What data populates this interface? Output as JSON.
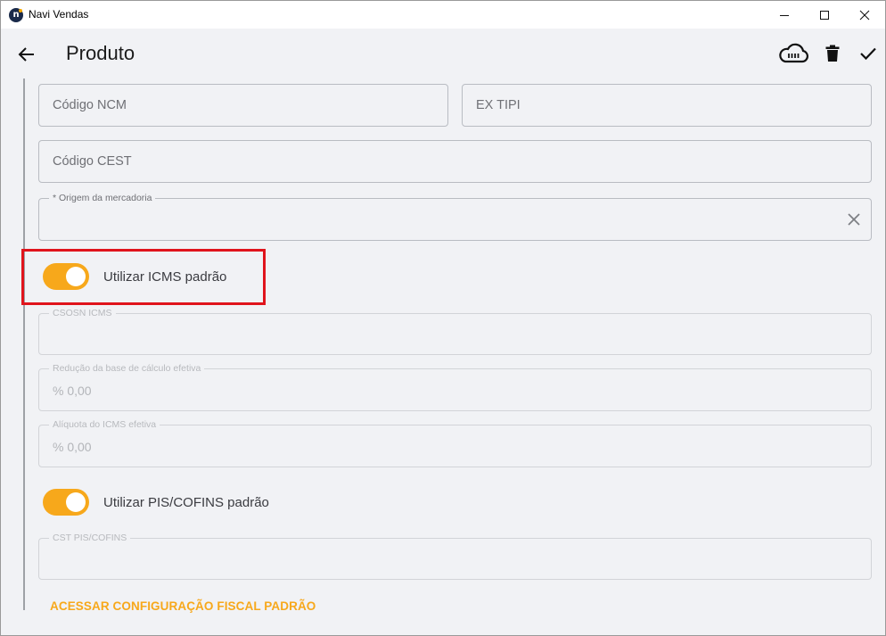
{
  "window": {
    "title": "Navi Vendas",
    "controls": {
      "minimize": "minimize-icon",
      "maximize": "maximize-icon",
      "close": "close-icon"
    }
  },
  "header": {
    "title": "Produto",
    "actions": [
      "cloud-sync-icon",
      "trash-icon",
      "check-icon"
    ]
  },
  "fields": {
    "ncm": {
      "placeholder": "Código NCM"
    },
    "ex_tipi": {
      "placeholder": "EX TIPI"
    },
    "cest": {
      "placeholder": "Código CEST"
    },
    "origem": {
      "label": "* Origem da mercadoria",
      "value": ""
    },
    "csosn": {
      "label": "CSOSN ICMS",
      "value": ""
    },
    "reducao": {
      "label": "Redução da base de cálculo efetiva",
      "value": "% 0,00"
    },
    "aliquota": {
      "label": "Alíquota do ICMS efetiva",
      "value": "% 0,00"
    },
    "cst_pis": {
      "label": "CST PIS/COFINS",
      "value": ""
    }
  },
  "toggles": {
    "icms": {
      "label": "Utilizar ICMS padrão",
      "on": true
    },
    "pis": {
      "label": "Utilizar PIS/COFINS padrão",
      "on": true
    }
  },
  "links": {
    "fiscal": "ACESSAR CONFIGURAÇÃO FISCAL PADRÃO"
  },
  "colors": {
    "accent": "#f7a81b",
    "highlight": "#e0141c",
    "background": "#f1f2f5"
  }
}
